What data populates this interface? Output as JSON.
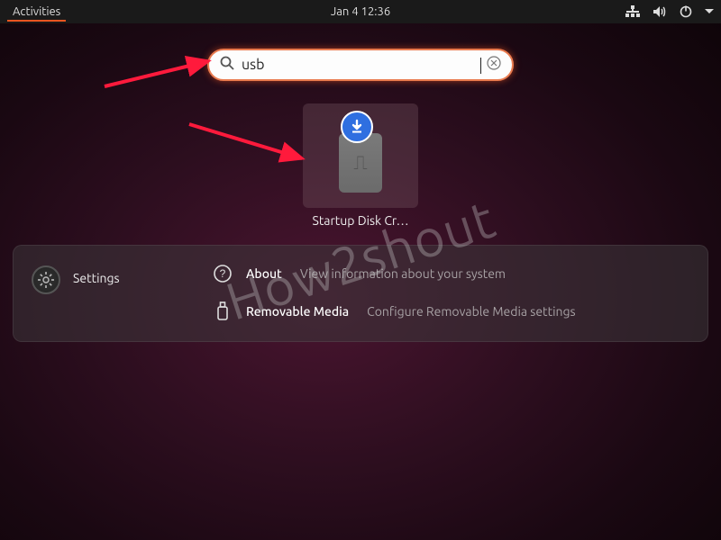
{
  "topbar": {
    "activities": "Activities",
    "clock": "Jan 4  12:36"
  },
  "search": {
    "value": "usb"
  },
  "result": {
    "label": "Startup Disk Cr…"
  },
  "settings": {
    "title": "Settings",
    "items": [
      {
        "name": "About",
        "desc": "View information about your system"
      },
      {
        "name": "Removable Media",
        "desc": "Configure Removable Media settings"
      }
    ]
  },
  "watermark": "How2shout"
}
